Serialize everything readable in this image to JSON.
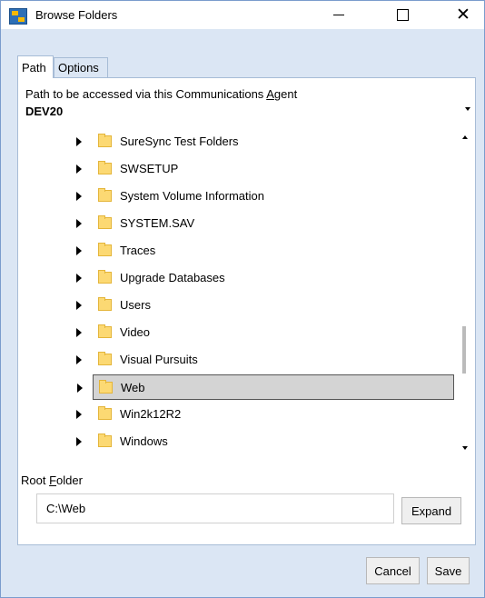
{
  "window": {
    "title": "Browse Folders",
    "controls": {
      "minimize": "minimize",
      "maximize": "maximize",
      "close": "close"
    }
  },
  "tabs": [
    {
      "label": "Path",
      "active": true
    },
    {
      "label": "Options",
      "active": false
    }
  ],
  "path": {
    "label_pre": "Path to be accessed via this Communications ",
    "label_key": "A",
    "label_post": "gent",
    "selected": "DEV20"
  },
  "tree": {
    "rows": [
      {
        "label": "SureSync Test Folders",
        "selected": false
      },
      {
        "label": "SWSETUP",
        "selected": false
      },
      {
        "label": "System Volume Information",
        "selected": false
      },
      {
        "label": "SYSTEM.SAV",
        "selected": false
      },
      {
        "label": "Traces",
        "selected": false
      },
      {
        "label": "Upgrade Databases",
        "selected": false
      },
      {
        "label": "Users",
        "selected": false
      },
      {
        "label": "Video",
        "selected": false
      },
      {
        "label": "Visual Pursuits",
        "selected": false
      },
      {
        "label": "Web",
        "selected": true
      },
      {
        "label": "Win2k12R2",
        "selected": false
      },
      {
        "label": "Windows",
        "selected": false
      }
    ]
  },
  "root_folder": {
    "label_pre": "Root ",
    "label_key": "F",
    "label_post": "older",
    "value": "C:\\Web"
  },
  "buttons": {
    "expand": "Expand",
    "cancel": "Cancel",
    "save": "Save"
  },
  "colors": {
    "title_bg": "#ffffff",
    "window_bg": "#dbe6f4",
    "selected_row": "#d4d4d4",
    "folder": "#fcd973"
  }
}
